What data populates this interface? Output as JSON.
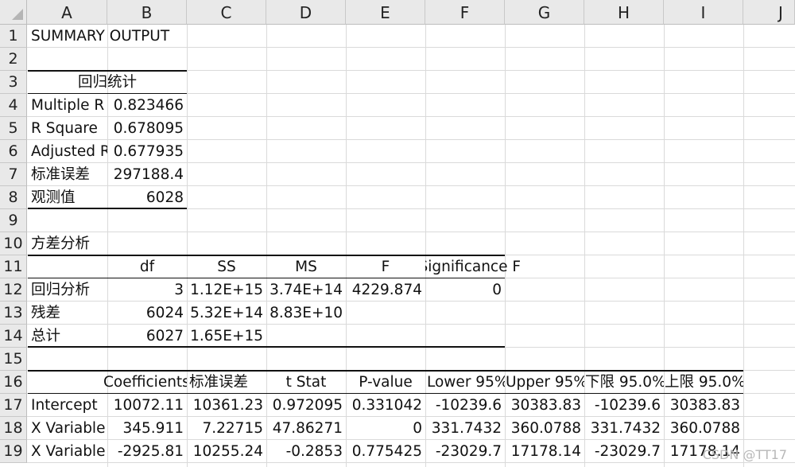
{
  "column_headers": [
    "A",
    "B",
    "C",
    "D",
    "E",
    "F",
    "G",
    "H",
    "I",
    "J"
  ],
  "row_numbers": [
    "1",
    "2",
    "3",
    "4",
    "5",
    "6",
    "7",
    "8",
    "9",
    "10",
    "11",
    "12",
    "13",
    "14",
    "15",
    "16",
    "17",
    "18",
    "19"
  ],
  "title": "SUMMARY OUTPUT",
  "regression_stats": {
    "header": "回归统计",
    "rows": [
      {
        "label": "Multiple R",
        "value": "0.823466"
      },
      {
        "label": "R Square",
        "value": "0.678095"
      },
      {
        "label": "Adjusted R",
        "value": "0.677935"
      },
      {
        "label": "标准误差",
        "value": "297188.4"
      },
      {
        "label": "观测值",
        "value": "6028"
      }
    ]
  },
  "anova": {
    "title": "方差分析",
    "headers": [
      "df",
      "SS",
      "MS",
      "F",
      "Significance F"
    ],
    "rows": [
      {
        "label": "回归分析",
        "df": "3",
        "ss": "1.12E+15",
        "ms": "3.74E+14",
        "f": "4229.874",
        "sig": "0"
      },
      {
        "label": "残差",
        "df": "6024",
        "ss": "5.32E+14",
        "ms": "8.83E+10",
        "f": "",
        "sig": ""
      },
      {
        "label": "总计",
        "df": "6027",
        "ss": "1.65E+15",
        "ms": "",
        "f": "",
        "sig": ""
      }
    ]
  },
  "coefficients": {
    "headers": [
      "Coefficients",
      "标准误差",
      "t Stat",
      "P-value",
      "Lower 95%",
      "Upper 95%",
      "下限 95.0%",
      "上限 95.0%"
    ],
    "rows": [
      {
        "label": "Intercept",
        "values": [
          "10072.11",
          "10361.23",
          "0.972095",
          "0.331042",
          "-10239.6",
          "30383.83",
          "-10239.6",
          "30383.83"
        ]
      },
      {
        "label": "X Variable",
        "values": [
          "345.911",
          "7.22715",
          "47.86271",
          "0",
          "331.7432",
          "360.0788",
          "331.7432",
          "360.0788"
        ]
      },
      {
        "label": "X Variable",
        "values": [
          "-2925.81",
          "10255.24",
          "-0.2853",
          "0.775425",
          "-23029.7",
          "17178.14",
          "-23029.7",
          "17178.14"
        ]
      }
    ]
  },
  "watermark": "CSDN @TT17"
}
